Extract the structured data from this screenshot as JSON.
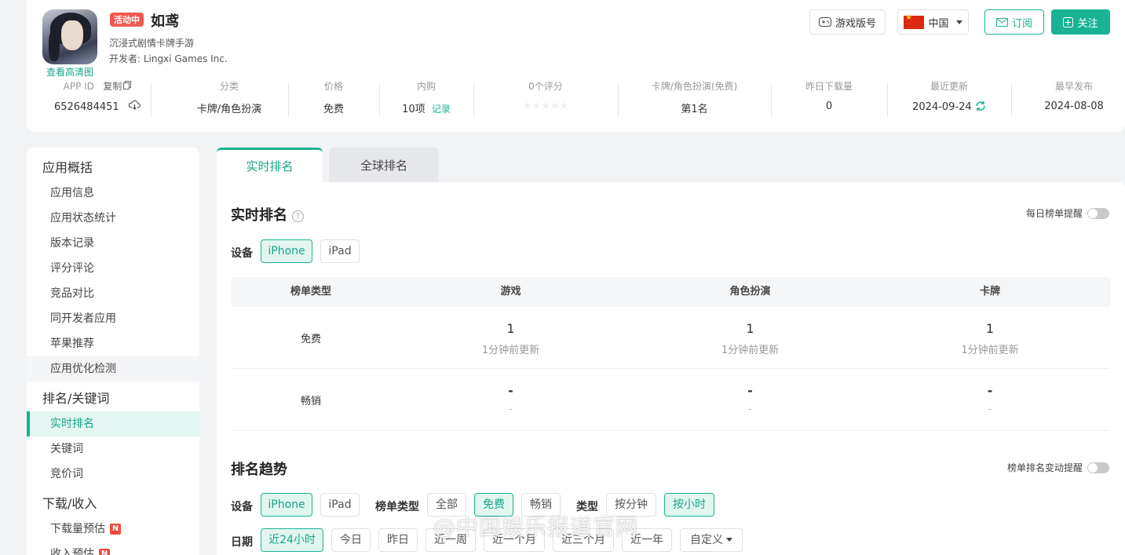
{
  "app": {
    "badge": "活动中",
    "name": "如鸢",
    "subtitle": "沉浸式剧情卡牌手游",
    "developer": "开发者: Lingxi Games Inc.",
    "hd_link": "查看高清图"
  },
  "header_buttons": {
    "version": "游戏版号",
    "country": "中国",
    "subscribe": "订阅",
    "follow": "关注"
  },
  "stats": {
    "app_id_label": "APP ID",
    "copy_label": "复制",
    "app_id": "6526484451",
    "category_label": "分类",
    "category": "卡牌/角色扮演",
    "price_label": "价格",
    "price": "免费",
    "iap_label": "内购",
    "iap": "10项",
    "iap_link": "记录",
    "rating_label": "0个评分",
    "rank_label": "卡牌/角色扮演(免费)",
    "rank": "第1名",
    "downloads_label": "昨日下载量",
    "downloads": "0",
    "updated_label": "最近更新",
    "updated": "2024-09-24",
    "released_label": "最早发布",
    "released": "2024-08-08"
  },
  "sidebar": {
    "groups": [
      {
        "title": "应用概括",
        "items": [
          "应用信息",
          "应用状态统计",
          "版本记录",
          "评分评论",
          "竞品对比",
          "同开发者应用",
          "苹果推荐",
          "应用优化检测"
        ]
      },
      {
        "title": "排名/关键词",
        "items": [
          "实时排名",
          "关键词",
          "竞价词"
        ]
      },
      {
        "title": "下载/收入",
        "items": [
          "下载量预估",
          "收入预估"
        ]
      }
    ],
    "new_badge": "N"
  },
  "tabs": {
    "realtime": "实时排名",
    "global": "全球排名"
  },
  "realtime": {
    "title": "实时排名",
    "help": "?",
    "reminder": "每日榜单提醒",
    "device_label": "设备",
    "devices": [
      "iPhone",
      "iPad"
    ],
    "table": {
      "headers": [
        "榜单类型",
        "游戏",
        "角色扮演",
        "卡牌"
      ],
      "rows": [
        {
          "type": "免费",
          "cells": [
            {
              "rank": "1",
              "upd": "1分钟前更新"
            },
            {
              "rank": "1",
              "upd": "1分钟前更新"
            },
            {
              "rank": "1",
              "upd": "1分钟前更新"
            }
          ]
        },
        {
          "type": "畅销",
          "cells": [
            {
              "rank": "-",
              "upd": "-"
            },
            {
              "rank": "-",
              "upd": "-"
            },
            {
              "rank": "-",
              "upd": "-"
            }
          ]
        }
      ]
    }
  },
  "trend": {
    "title": "排名趋势",
    "reminder": "榜单排名变动提醒",
    "device_label": "设备",
    "devices": [
      "iPhone",
      "iPad"
    ],
    "list_type_label": "榜单类型",
    "list_types": [
      "全部",
      "免费",
      "畅销"
    ],
    "type_label": "类型",
    "types": [
      "按分钟",
      "按小时"
    ],
    "date_label": "日期",
    "dates": [
      "近24小时",
      "今日",
      "昨日",
      "近一周",
      "近一个月",
      "近三个月",
      "近一年",
      "自定义"
    ]
  },
  "watermark": "@中国娱乐报道官网",
  "colors": {
    "accent": "#19b394",
    "badge_red": "#f05a4f"
  }
}
